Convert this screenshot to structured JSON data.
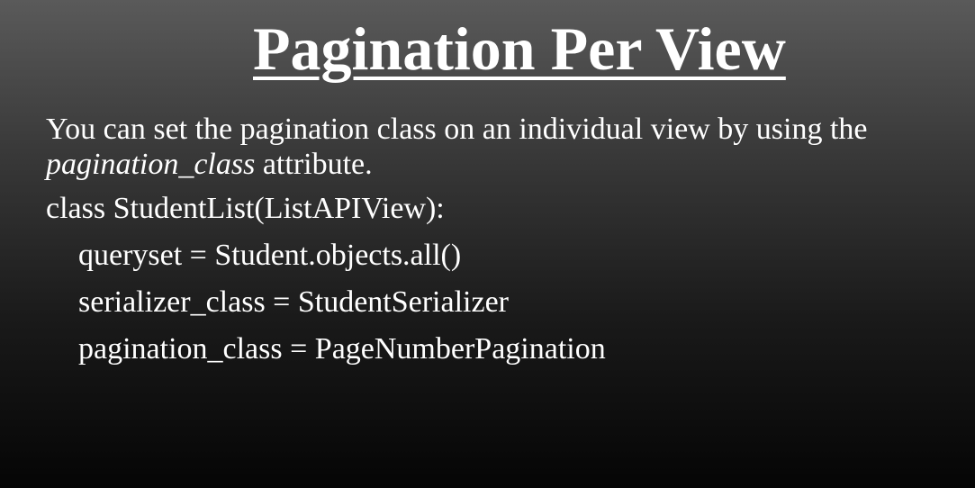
{
  "slide": {
    "title": "Pagination Per View",
    "paragraph": {
      "text_before": "You can set the pagination class on an individual view by using the",
      "emphasis": "pagination_class",
      "text_after": " attribute."
    },
    "code": [
      "class StudentList(ListAPIView):",
      "queryset = Student.objects.all()",
      "serializer_class = StudentSerializer",
      "pagination_class = PageNumberPagination"
    ]
  }
}
